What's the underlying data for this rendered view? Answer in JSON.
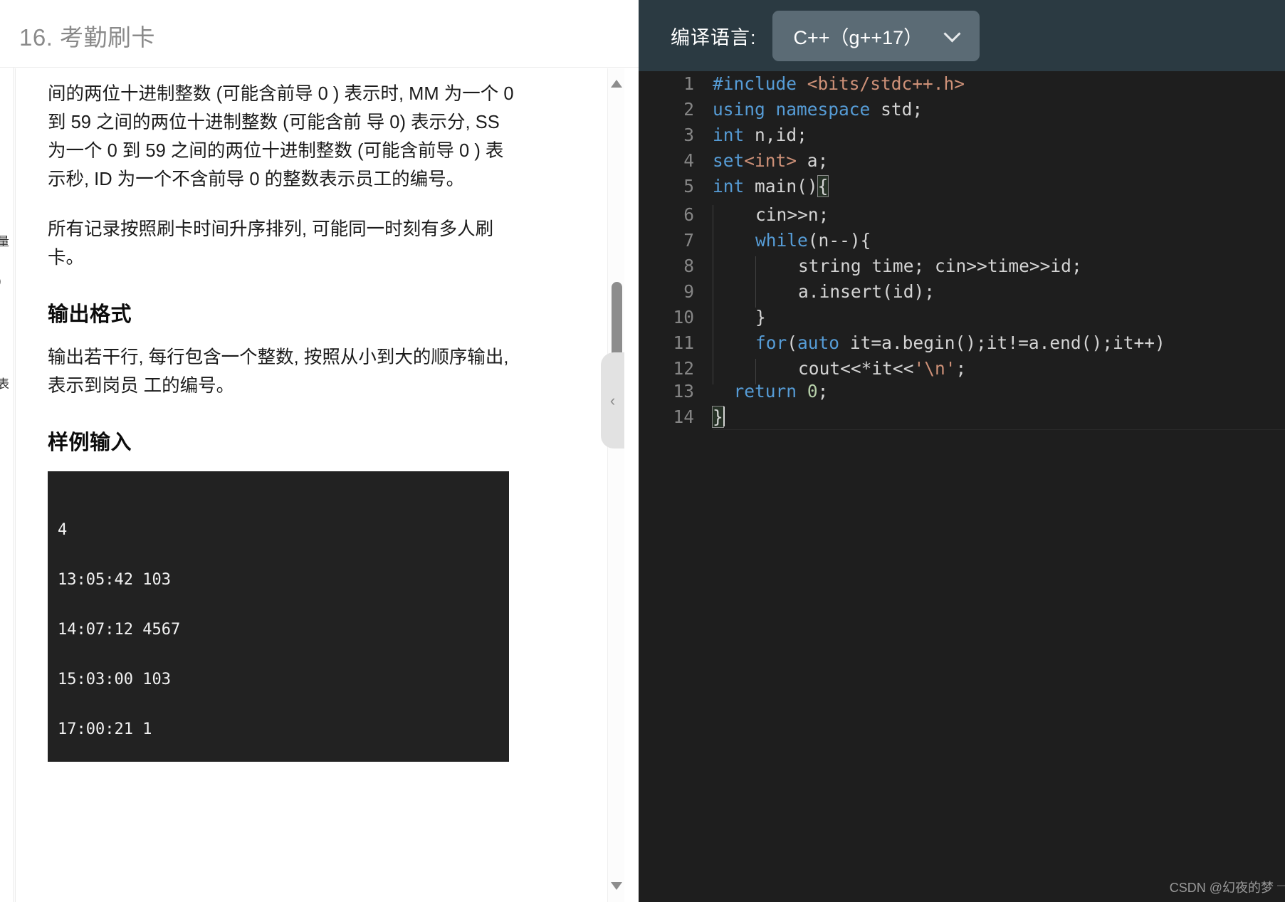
{
  "problem": {
    "title": "16. 考勤刷卡",
    "paragraphs": [
      "间的两位十进制整数 (可能含前导 0 ) 表示时, MM 为一个 0 到 59 之间的两位十进制整数 (可能含前 导 0) 表示分, SS 为一个 0 到 59 之间的两位十进制整数 (可能含前导 0 ) 表 示秒, ID 为一个不含前导 0 的整数表示员工的编号。",
      "所有记录按照刷卡时间升序排列, 可能同一时刻有多人刷卡。"
    ],
    "output_format_heading": "输出格式",
    "output_format_text": "输出若干行, 每行包含一个整数, 按照从小到大的顺序输出, 表示到岗员 工的编号。",
    "sample_input_heading": "样例输入",
    "sample_input_lines": [
      "4",
      "13:05:42 103",
      "14:07:12 4567",
      "15:03:00 103",
      "17:00:21 1"
    ]
  },
  "scrollbar": {
    "up_arrow_icon": "triangle-up-icon",
    "down_arrow_icon": "triangle-down-icon",
    "collapse_icon": "chevron-left-icon",
    "collapse_glyph": "‹"
  },
  "editor": {
    "lang_label": "编译语言:",
    "lang_value": "C++（g++17）",
    "chevron_icon": "chevron-down-icon",
    "code_lines": [
      {
        "n": "1",
        "text": "#include <bits/stdc++.h>"
      },
      {
        "n": "2",
        "text": "using namespace std;"
      },
      {
        "n": "3",
        "text": "int n,id;"
      },
      {
        "n": "4",
        "text": "set<int> a;"
      },
      {
        "n": "5",
        "text": "int main(){"
      },
      {
        "n": "6",
        "text": "    cin>>n;"
      },
      {
        "n": "7",
        "text": "    while(n--){"
      },
      {
        "n": "8",
        "text": "        string time; cin>>time>>id;"
      },
      {
        "n": "9",
        "text": "        a.insert(id);"
      },
      {
        "n": "10",
        "text": "    }"
      },
      {
        "n": "11",
        "text": "    for(auto it=a.begin();it!=a.end();it++)"
      },
      {
        "n": "12",
        "text": "        cout<<*it<<'\\n';"
      },
      {
        "n": "13",
        "text": "  return 0;"
      },
      {
        "n": "14",
        "text": "}"
      }
    ]
  },
  "watermark": {
    "text": "CSDN @幻夜的梦"
  },
  "colors": {
    "editor_bg": "#1e1e1e",
    "topbar_bg": "#2b3a42",
    "select_bg": "#5b6b75",
    "keyword": "#569cd6",
    "string": "#ce9178",
    "number": "#b5cea8",
    "plain": "#d4d4d4",
    "gutter": "#858585",
    "title": "#8a8a8a"
  }
}
